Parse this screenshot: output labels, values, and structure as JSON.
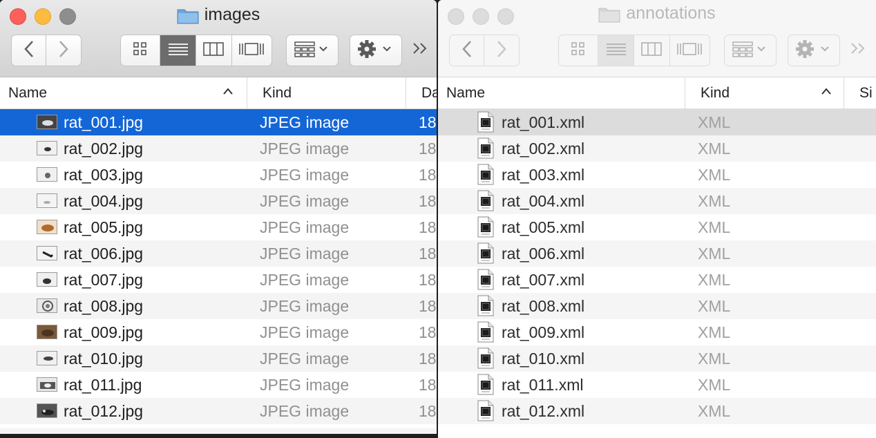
{
  "left_window": {
    "title": "images",
    "columns": {
      "name": "Name",
      "kind": "Kind",
      "date": "Da"
    },
    "rows": [
      {
        "name": "rat_001.jpg",
        "kind": "JPEG image",
        "date": "18",
        "selected": true
      },
      {
        "name": "rat_002.jpg",
        "kind": "JPEG image",
        "date": "18"
      },
      {
        "name": "rat_003.jpg",
        "kind": "JPEG image",
        "date": "18"
      },
      {
        "name": "rat_004.jpg",
        "kind": "JPEG image",
        "date": "18"
      },
      {
        "name": "rat_005.jpg",
        "kind": "JPEG image",
        "date": "18"
      },
      {
        "name": "rat_006.jpg",
        "kind": "JPEG image",
        "date": "18"
      },
      {
        "name": "rat_007.jpg",
        "kind": "JPEG image",
        "date": "18"
      },
      {
        "name": "rat_008.jpg",
        "kind": "JPEG image",
        "date": "18"
      },
      {
        "name": "rat_009.jpg",
        "kind": "JPEG image",
        "date": "18"
      },
      {
        "name": "rat_010.jpg",
        "kind": "JPEG image",
        "date": "18"
      },
      {
        "name": "rat_011.jpg",
        "kind": "JPEG image",
        "date": "18"
      },
      {
        "name": "rat_012.jpg",
        "kind": "JPEG image",
        "date": "18"
      }
    ]
  },
  "right_window": {
    "title": "annotations",
    "columns": {
      "name": "Name",
      "kind": "Kind",
      "size": "Si"
    },
    "rows": [
      {
        "name": "rat_001.xml",
        "kind": "XML",
        "selected": true
      },
      {
        "name": "rat_002.xml",
        "kind": "XML"
      },
      {
        "name": "rat_003.xml",
        "kind": "XML"
      },
      {
        "name": "rat_004.xml",
        "kind": "XML"
      },
      {
        "name": "rat_005.xml",
        "kind": "XML"
      },
      {
        "name": "rat_006.xml",
        "kind": "XML"
      },
      {
        "name": "rat_007.xml",
        "kind": "XML"
      },
      {
        "name": "rat_008.xml",
        "kind": "XML"
      },
      {
        "name": "rat_009.xml",
        "kind": "XML"
      },
      {
        "name": "rat_010.xml",
        "kind": "XML"
      },
      {
        "name": "rat_011.xml",
        "kind": "XML"
      },
      {
        "name": "rat_012.xml",
        "kind": "XML"
      }
    ]
  },
  "colors": {
    "selection": "#1466d6",
    "inactive_selection": "#dcdcdc",
    "close": "#fc605b",
    "minimize": "#fdbc40",
    "zoom": "#34c84a"
  },
  "icons": {
    "back": "chevron-left-icon",
    "forward": "chevron-right-icon",
    "view_icons": "grid-icon",
    "view_list": "list-icon",
    "view_columns": "columns-icon",
    "view_gallery": "gallery-icon",
    "group": "group-icon",
    "action": "gear-icon",
    "more": "double-chevron-icon"
  }
}
